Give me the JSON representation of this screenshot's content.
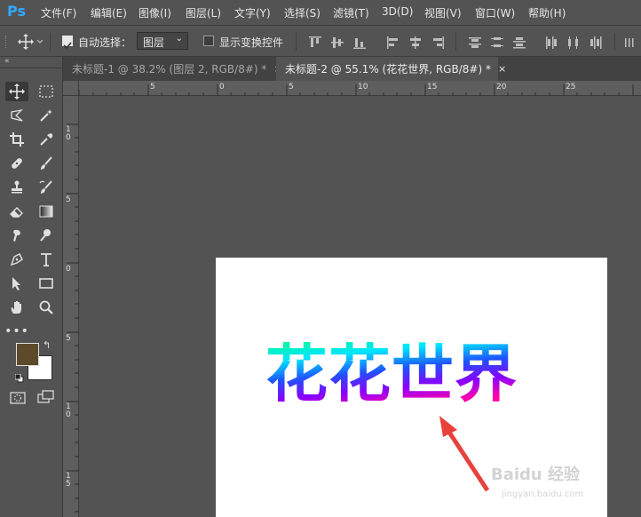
{
  "app": {
    "logo": "Ps"
  },
  "menu": [
    "文件(F)",
    "编辑(E)",
    "图像(I)",
    "图层(L)",
    "文字(Y)",
    "选择(S)",
    "滤镜(T)",
    "3D(D)",
    "视图(V)",
    "窗口(W)",
    "帮助(H)"
  ],
  "options": {
    "auto_select_label": "自动选择：",
    "auto_select_checked": true,
    "layer_select_value": "图层",
    "show_transform_label": "显示变换控件",
    "show_transform_checked": false
  },
  "tabs": [
    {
      "label": "未标题-1 @ 38.2% (图层 2, RGB/8#) *",
      "close": "×"
    },
    {
      "label": "未标题-2 @ 55.1% (花花世界, RGB/8#) *",
      "close": "×"
    }
  ],
  "ruler_top_labels": [
    "5",
    "0",
    "5",
    "10",
    "15",
    "20",
    "25"
  ],
  "ruler_left_labels": [
    "1\n0",
    "5",
    "0",
    "5",
    "1\n0",
    "1\n5"
  ],
  "canvas": {
    "text": "花花世界",
    "gradient_colors": [
      "#00ff7f",
      "#00e5ff",
      "#2050ff",
      "#8a00ff",
      "#ff00aa"
    ]
  },
  "colors": {
    "foreground": "#5c4a2a",
    "background": "#ffffff",
    "arrow": "#e8413c"
  },
  "watermark": {
    "brand": "Baidu 经验",
    "url": "jingyan.baidu.com"
  }
}
